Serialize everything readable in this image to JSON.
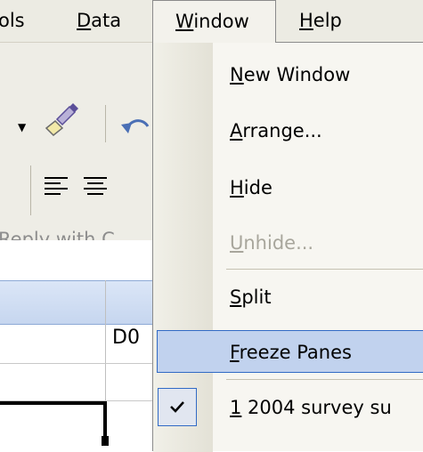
{
  "menubar": {
    "tools": {
      "pre": "ols",
      "ul": "",
      "post": ""
    },
    "data": {
      "pre": "",
      "ul": "D",
      "post": "ata"
    },
    "window": {
      "pre": "",
      "ul": "W",
      "post": "indow"
    },
    "help": {
      "pre": "",
      "ul": "H",
      "post": "elp"
    }
  },
  "toolbar": {
    "reply_text": "Reply with C",
    "icons": [
      "dropdown-arrow-icon",
      "format-painter-icon",
      "undo-icon",
      "align-left-icon",
      "align-center-icon"
    ]
  },
  "sheet": {
    "cell_text": "D0"
  },
  "window_menu": {
    "items": [
      {
        "ul": "N",
        "rest": "ew Window",
        "state": "enabled"
      },
      {
        "ul": "A",
        "rest": "rrange...",
        "state": "enabled"
      },
      {
        "ul": "H",
        "rest": "ide",
        "state": "enabled"
      },
      {
        "ul": "U",
        "rest": "nhide...",
        "state": "disabled"
      },
      {
        "ul": "S",
        "rest": "plit",
        "state": "enabled"
      },
      {
        "ul": "F",
        "rest": "reeze Panes",
        "state": "highlighted"
      },
      {
        "ul": "1",
        "rest": " 2004 survey su",
        "state": "checked"
      }
    ]
  },
  "colors": {
    "highlight_fill": "#c1d2ee",
    "highlight_border": "#316ac5",
    "menubar_bg": "#ecebe3",
    "disabled_text": "#a8a69c"
  }
}
